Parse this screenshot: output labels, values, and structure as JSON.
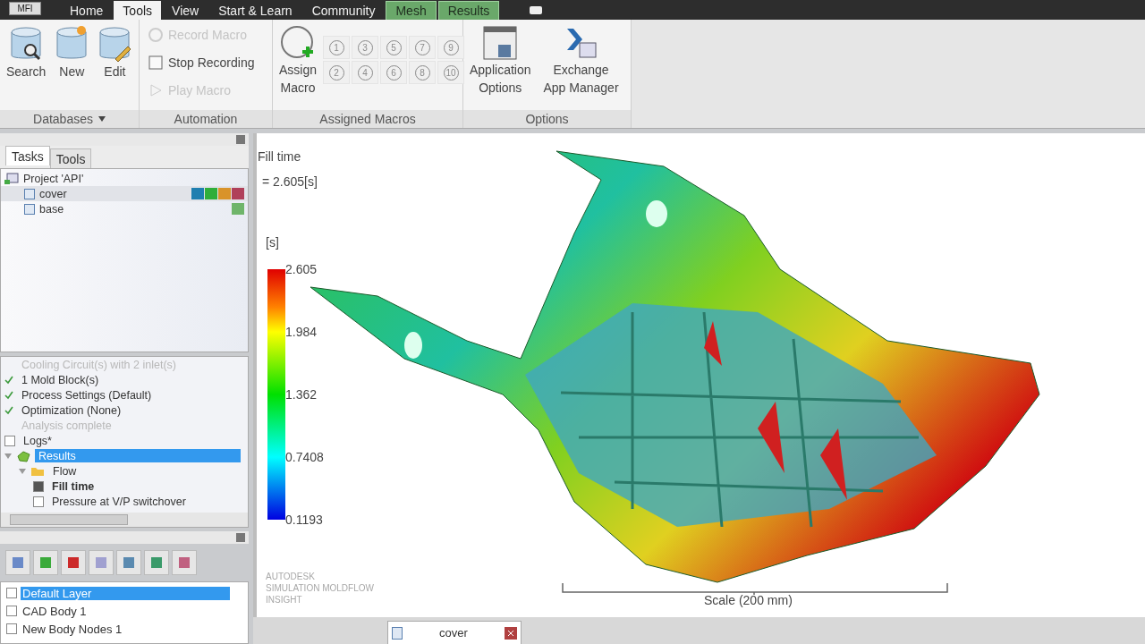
{
  "app_button": "MFI",
  "ribbon_tabs": [
    {
      "label": "Home",
      "selected": false,
      "kind": "standard"
    },
    {
      "label": "Tools",
      "selected": true,
      "kind": "standard"
    },
    {
      "label": "View",
      "selected": false,
      "kind": "standard"
    },
    {
      "label": "Start & Learn",
      "selected": false,
      "kind": "standard"
    },
    {
      "label": "Community",
      "selected": false,
      "kind": "standard"
    },
    {
      "label": "Mesh",
      "selected": false,
      "kind": "contextual"
    },
    {
      "label": "Results",
      "selected": false,
      "kind": "contextual"
    }
  ],
  "ribbon": {
    "databases": {
      "title": "Databases",
      "has_menu": true,
      "buttons": [
        {
          "label": "Search",
          "kind": "search"
        },
        {
          "label": "New",
          "kind": "new"
        },
        {
          "label": "Edit",
          "kind": "edit"
        }
      ]
    },
    "automation": {
      "title": "Automation",
      "items": [
        {
          "label": "Record Macro",
          "kind": "record",
          "disabled": true
        },
        {
          "label": "Stop Recording",
          "kind": "stop",
          "disabled": false
        },
        {
          "label": "Play Macro",
          "kind": "play",
          "disabled": true
        }
      ]
    },
    "assigned_macros": {
      "title": "Assigned Macros",
      "assign_button": [
        "Assign",
        "Macro"
      ],
      "slots": [
        {
          "label": "1",
          "disabled": true
        },
        {
          "label": "3",
          "disabled": true
        },
        {
          "label": "5",
          "disabled": true
        },
        {
          "label": "7",
          "disabled": true
        },
        {
          "label": "9",
          "disabled": true
        },
        {
          "label": "2",
          "disabled": true
        },
        {
          "label": "4",
          "disabled": true
        },
        {
          "label": "6",
          "disabled": true
        },
        {
          "label": "8",
          "disabled": true
        },
        {
          "label": "10",
          "disabled": true
        }
      ]
    },
    "options": {
      "title": "Options",
      "buttons": [
        {
          "lines": [
            "Application",
            "Options"
          ],
          "kind": "window"
        },
        {
          "lines": [
            "Exchange",
            "App Manager"
          ],
          "kind": "exchange"
        }
      ]
    }
  },
  "panel_tabs": [
    {
      "label": "Tasks",
      "selected": true
    },
    {
      "label": "Tools",
      "selected": false
    }
  ],
  "project_tree": {
    "label": "Project 'API'",
    "children": [
      {
        "label": "cover",
        "selected": true,
        "badges": [
          {
            "color": "#1f7fb0"
          },
          {
            "color": "#2fae3a"
          },
          {
            "color": "#d9932a"
          },
          {
            "color": "#b0405a"
          }
        ]
      },
      {
        "label": "base",
        "selected": false,
        "badges": [
          {
            "color": "#6fb56a"
          }
        ]
      }
    ]
  },
  "study_tree": [
    {
      "label": "Cooling Circuit(s) with 2 inlet(s)",
      "kind": "step",
      "checked": false,
      "disabled": true,
      "selected": false
    },
    {
      "label": "1 Mold Block(s)",
      "kind": "step",
      "checked": true,
      "disabled": false,
      "selected": false
    },
    {
      "label": "Process Settings (Default)",
      "kind": "step",
      "checked": true,
      "disabled": false,
      "selected": false
    },
    {
      "label": "Optimization (None)",
      "kind": "step",
      "checked": true,
      "disabled": false,
      "selected": false
    },
    {
      "label": "Analysis complete",
      "kind": "step",
      "checked": false,
      "disabled": true,
      "selected": false
    },
    {
      "label": "Logs*",
      "kind": "checkbox",
      "checked": false,
      "selected": false
    },
    {
      "label": "Results",
      "kind": "results",
      "selected": true,
      "expanded": true,
      "children": [
        {
          "label": "Flow",
          "kind": "folder",
          "selected": false,
          "expanded": true,
          "children": [
            {
              "label": "Fill time",
              "kind": "checkbox",
              "checked": true,
              "selected": true
            },
            {
              "label": "Pressure at V/P switchover",
              "kind": "checkbox",
              "checked": false,
              "selected": false
            }
          ]
        }
      ]
    }
  ],
  "layers": [
    {
      "label": "Default Layer",
      "selected": true,
      "checked": false
    },
    {
      "label": "CAD Body 1",
      "selected": false,
      "checked": false
    },
    {
      "label": "New Body Nodes 1",
      "selected": false,
      "checked": false
    }
  ],
  "viewport": {
    "result_title": "Fill time",
    "result_value": "= 2.605[s]",
    "legend_unit": "[s]",
    "legend_labels": [
      "2.605",
      "1.984",
      "1.362",
      "0.7408",
      "0.1193"
    ],
    "branding": [
      "AUTODESK",
      "SIMULATION MOLDFLOW",
      "INSIGHT"
    ],
    "scale_label": "Scale (200 mm)"
  },
  "document_tabs": [
    {
      "label": "cover",
      "selected": true
    }
  ]
}
